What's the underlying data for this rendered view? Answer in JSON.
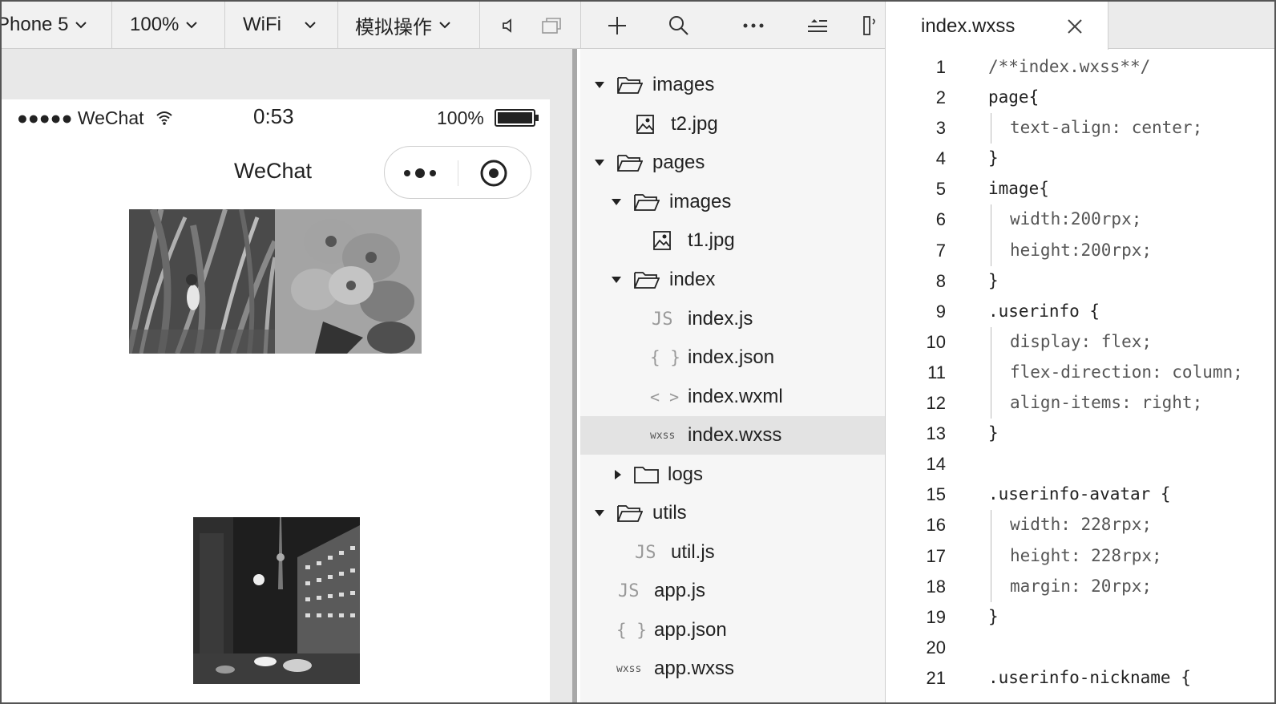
{
  "toolbar": {
    "device": "Phone 5",
    "zoom": "100%",
    "network": "WiFi",
    "simulate": "模拟操作"
  },
  "simulator": {
    "status_left": "●●●●● WeChat",
    "status_time": "0:53",
    "status_battery": "100%",
    "nav_title": "WeChat"
  },
  "file_tree": [
    {
      "name": "images",
      "type": "folder",
      "open": true
    },
    {
      "name": "t2.jpg",
      "type": "image"
    },
    {
      "name": "pages",
      "type": "folder",
      "open": true
    },
    {
      "name": "images",
      "type": "folder",
      "open": true
    },
    {
      "name": "t1.jpg",
      "type": "image"
    },
    {
      "name": "index",
      "type": "folder",
      "open": true
    },
    {
      "name": "index.js",
      "type": "js",
      "tag": "JS"
    },
    {
      "name": "index.json",
      "type": "json",
      "tag": "{ }"
    },
    {
      "name": "index.wxml",
      "type": "wxml",
      "tag": "< >"
    },
    {
      "name": "index.wxss",
      "type": "wxss",
      "tag": "wxss",
      "selected": true
    },
    {
      "name": "logs",
      "type": "folder",
      "open": false
    },
    {
      "name": "utils",
      "type": "folder",
      "open": true
    },
    {
      "name": "util.js",
      "type": "js",
      "tag": "JS"
    },
    {
      "name": "app.js",
      "type": "js",
      "tag": "JS"
    },
    {
      "name": "app.json",
      "type": "json",
      "tag": "{ }"
    },
    {
      "name": "app.wxss",
      "type": "wxss",
      "tag": "wxss"
    }
  ],
  "editor": {
    "tab": "index.wxss",
    "lines": [
      {
        "n": "1",
        "text": "/**index.wxss**/"
      },
      {
        "n": "2",
        "text": "page{"
      },
      {
        "n": "3",
        "text": "text-align: center;"
      },
      {
        "n": "4",
        "text": "}"
      },
      {
        "n": "5",
        "text": "image{"
      },
      {
        "n": "6",
        "text": "width:200rpx;"
      },
      {
        "n": "7",
        "text": "height:200rpx;"
      },
      {
        "n": "8",
        "text": "}"
      },
      {
        "n": "9",
        "text": ".userinfo {"
      },
      {
        "n": "10",
        "text": "display: flex;"
      },
      {
        "n": "11",
        "text": "flex-direction: column;"
      },
      {
        "n": "12",
        "text": "align-items: right;"
      },
      {
        "n": "13",
        "text": "}"
      },
      {
        "n": "14",
        "text": ""
      },
      {
        "n": "15",
        "text": ".userinfo-avatar {"
      },
      {
        "n": "16",
        "text": "width: 228rpx;"
      },
      {
        "n": "17",
        "text": "height: 228rpx;"
      },
      {
        "n": "18",
        "text": "margin: 20rpx;"
      },
      {
        "n": "19",
        "text": "}"
      },
      {
        "n": "20",
        "text": ""
      },
      {
        "n": "21",
        "text": ".userinfo-nickname {"
      }
    ]
  }
}
